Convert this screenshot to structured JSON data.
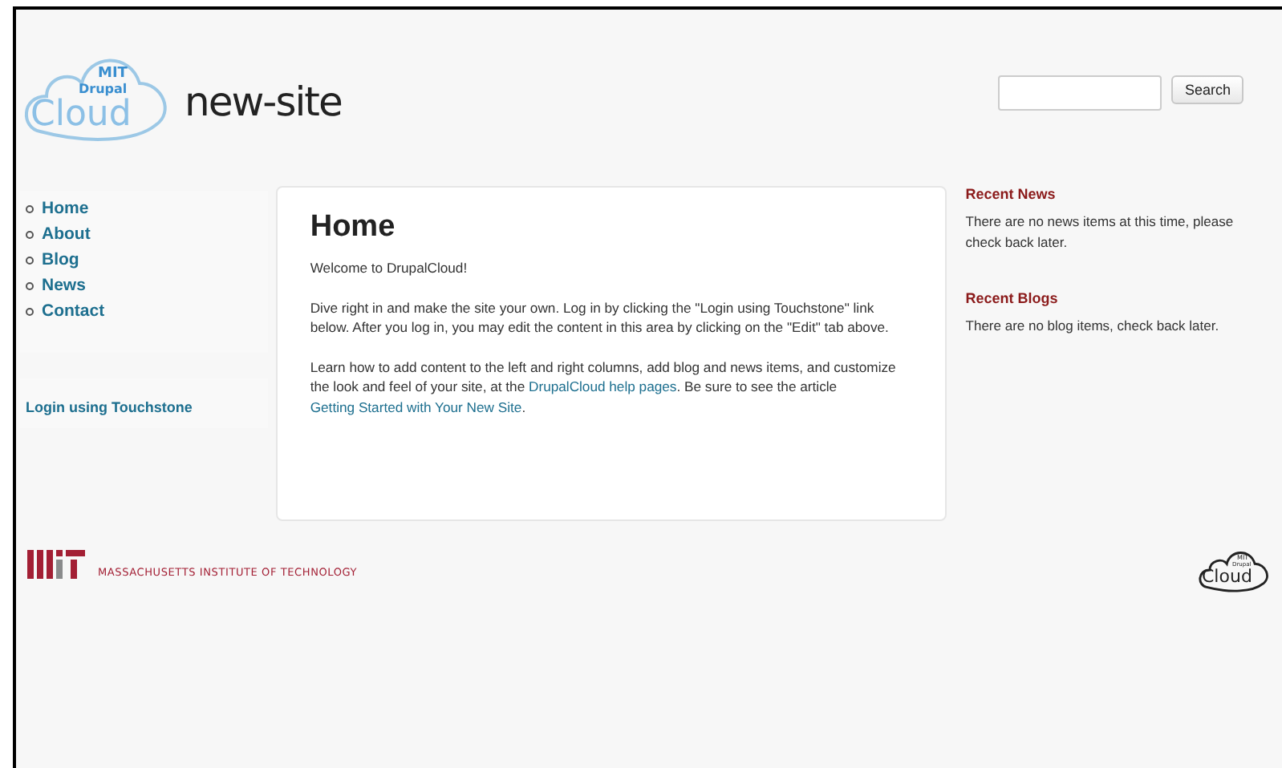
{
  "header": {
    "logo": {
      "line_1": "MIT",
      "line_2": "Drupal",
      "line_3": "Cloud"
    },
    "site_name": "new-site",
    "search": {
      "button": "Search"
    }
  },
  "nav": {
    "items": [
      {
        "label": "Home"
      },
      {
        "label": "About"
      },
      {
        "label": "Blog"
      },
      {
        "label": "News"
      },
      {
        "label": "Contact"
      }
    ],
    "login": "Login using Touchstone"
  },
  "main": {
    "title": "Home",
    "paragraphs": [
      {
        "parts": [
          {
            "text": "Welcome to DrupalCloud!",
            "kind": "text"
          }
        ]
      },
      {
        "parts": [
          {
            "text": "Dive right in and make the site your own. Log in by clicking the \"Login using Touchstone\" link below. After you log in, you may edit the content in this area by clicking on the \"Edit\" tab above.",
            "kind": "text"
          }
        ]
      },
      {
        "parts": [
          {
            "text": "Learn how to add content to the left and right columns, add blog and news items, and customize the look and feel of your site, at the ",
            "kind": "text"
          },
          {
            "text": "DrupalCloud help pages",
            "kind": "link"
          },
          {
            "text": ". Be sure to see the article ",
            "kind": "text"
          },
          {
            "text": "Getting Started with Your New Site",
            "kind": "link"
          },
          {
            "text": ".",
            "kind": "text"
          }
        ]
      }
    ]
  },
  "sidebar_right": [
    {
      "title": "Recent News",
      "text": "There are no news items at this time, please check back later."
    },
    {
      "title": "Recent Blogs",
      "text": "There are no blog items, check back later."
    }
  ],
  "footer": {
    "institute": "MASSACHUSETTS INSTITUTE OF TECHNOLOGY",
    "logo": {
      "line_1": "MIT",
      "line_2": "Drupal",
      "line_3": "Cloud"
    }
  }
}
